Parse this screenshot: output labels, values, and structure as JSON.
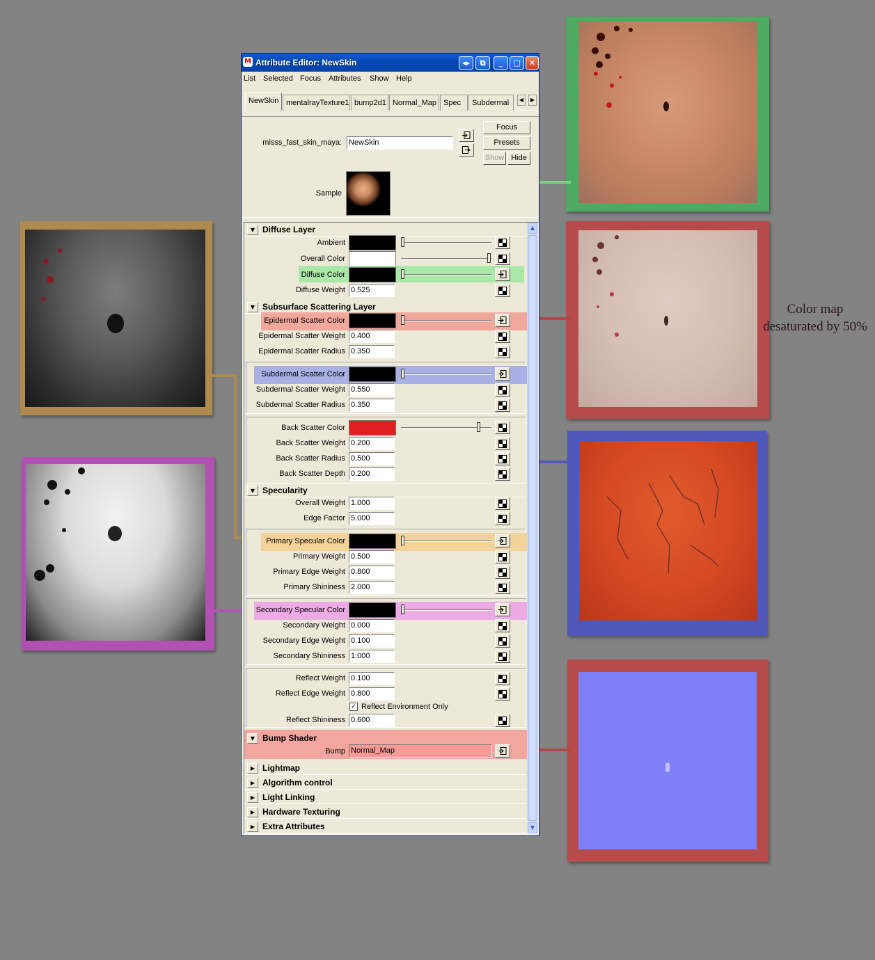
{
  "window": {
    "title": "Attribute Editor: NewSkin",
    "title_buttons": [
      "◂▸",
      "⧉",
      "_",
      "□",
      "✕"
    ]
  },
  "menu": [
    "List",
    "Selected",
    "Focus",
    "Attributes",
    "Show",
    "Help"
  ],
  "tabs": [
    "NewSkin",
    "mentalrayTexture1",
    "bump2d1",
    "Normal_Map",
    "Spec",
    "Subdermal"
  ],
  "header": {
    "node_type_label": "misss_fast_skin_maya:",
    "node_name": "NewSkin",
    "focus_label": "Focus",
    "presets_label": "Presets",
    "show_label": "Show",
    "hide_label": "Hide",
    "sample_label": "Sample"
  },
  "sections": {
    "diffuse": "Diffuse Layer",
    "sss": "Subsurface Scattering Layer",
    "specularity": "Specularity",
    "bump": "Bump Shader",
    "lightmap": "Lightmap",
    "algorithm": "Algorithm control",
    "lightlinking": "Light Linking",
    "hardware": "Hardware Texturing",
    "extra": "Extra Attributes"
  },
  "attrs": {
    "ambient": "Ambient",
    "overall_color": "Overall Color",
    "diffuse_color": "Diffuse Color",
    "diffuse_weight": "Diffuse Weight",
    "diffuse_weight_val": "0.525",
    "epi_color": "Epidermal Scatter Color",
    "epi_weight": "Epidermal Scatter Weight",
    "epi_weight_val": "0.400",
    "epi_radius": "Epidermal Scatter Radius",
    "epi_radius_val": "0.350",
    "sub_color": "Subdermal Scatter Color",
    "sub_weight": "Subdermal Scatter Weight",
    "sub_weight_val": "0.550",
    "sub_radius": "Subdermal Scatter Radius",
    "sub_radius_val": "0.350",
    "back_color": "Back Scatter Color",
    "back_weight": "Back Scatter Weight",
    "back_weight_val": "0.200",
    "back_radius": "Back Scatter Radius",
    "back_radius_val": "0.500",
    "back_depth": "Back Scatter Depth",
    "back_depth_val": "0.200",
    "overall_weight": "Overall Weight",
    "overall_weight_val": "1.000",
    "edge_factor": "Edge Factor",
    "edge_factor_val": "5.000",
    "prim_color": "Primary Specular Color",
    "prim_weight": "Primary Weight",
    "prim_weight_val": "0.500",
    "prim_edge": "Primary Edge Weight",
    "prim_edge_val": "0.800",
    "prim_shin": "Primary Shininess",
    "prim_shin_val": "2.000",
    "sec_color": "Secondary Specular Color",
    "sec_weight": "Secondary Weight",
    "sec_weight_val": "0.000",
    "sec_edge": "Secondary Edge Weight",
    "sec_edge_val": "0.100",
    "sec_shin": "Secondary Shininess",
    "sec_shin_val": "1.000",
    "refl_weight": "Reflect Weight",
    "refl_weight_val": "0.100",
    "refl_edge": "Reflect Edge Weight",
    "refl_edge_val": "0.800",
    "refl_env_only": "Reflect Environment Only",
    "refl_shin": "Reflect Shininess",
    "refl_shin_val": "0.600",
    "bump": "Bump",
    "bump_val": "Normal_Map"
  },
  "slider_levels": {
    "ambient": 0.0,
    "overall_color": 1.0,
    "diffuse_color": 0.0,
    "epi_color": 0.0,
    "sub_color": 0.0,
    "back_color": 0.88,
    "prim_color": 0.0,
    "sec_color": 0.0
  },
  "colors": {
    "titlebar": "#0747b5",
    "back_scatter": "#e02020",
    "overall": "#ffffff",
    "diffuse_hl": "#9fe8a0",
    "epidermal_hl": "#f29c92",
    "subdermal_hl": "#9ea6e6",
    "primary_hl": "#f5cf8f",
    "secondary_hl": "#ee9fe6",
    "bump_hl": "#f59a94"
  },
  "annotation": "Color map\ndesaturated by 50%",
  "thumbnails": [
    "diffuse-color-map",
    "epidermal-color-map",
    "subdermal-color-map",
    "normal-map",
    "primary-specular-map",
    "secondary-specular-map"
  ]
}
